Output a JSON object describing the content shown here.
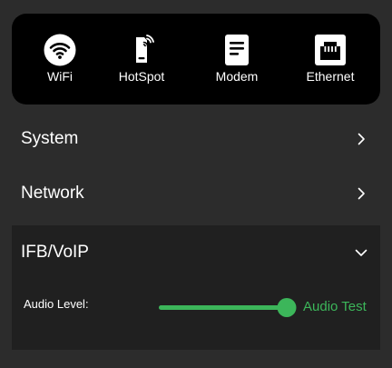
{
  "connection_types": [
    {
      "label": "WiFi",
      "icon": "wifi-icon"
    },
    {
      "label": "HotSpot",
      "icon": "hotspot-icon"
    },
    {
      "label": "Modem",
      "icon": "modem-icon"
    },
    {
      "label": "Ethernet",
      "icon": "ethernet-icon"
    }
  ],
  "menu": {
    "system": {
      "label": "System",
      "icon": "chevron-right-icon"
    },
    "network": {
      "label": "Network",
      "icon": "chevron-right-icon"
    },
    "ifb_voip": {
      "label": "IFB/VoIP",
      "icon": "chevron-down-icon",
      "audio_level_label": "Audio Level:",
      "audio_level_value": 0.94,
      "audio_test_label": "Audio Test"
    }
  },
  "colors": {
    "background": "#2c2c2c",
    "panel": "#000000",
    "expanded_section": "#202020",
    "accent": "#3cb65a",
    "text": "#ffffff"
  }
}
